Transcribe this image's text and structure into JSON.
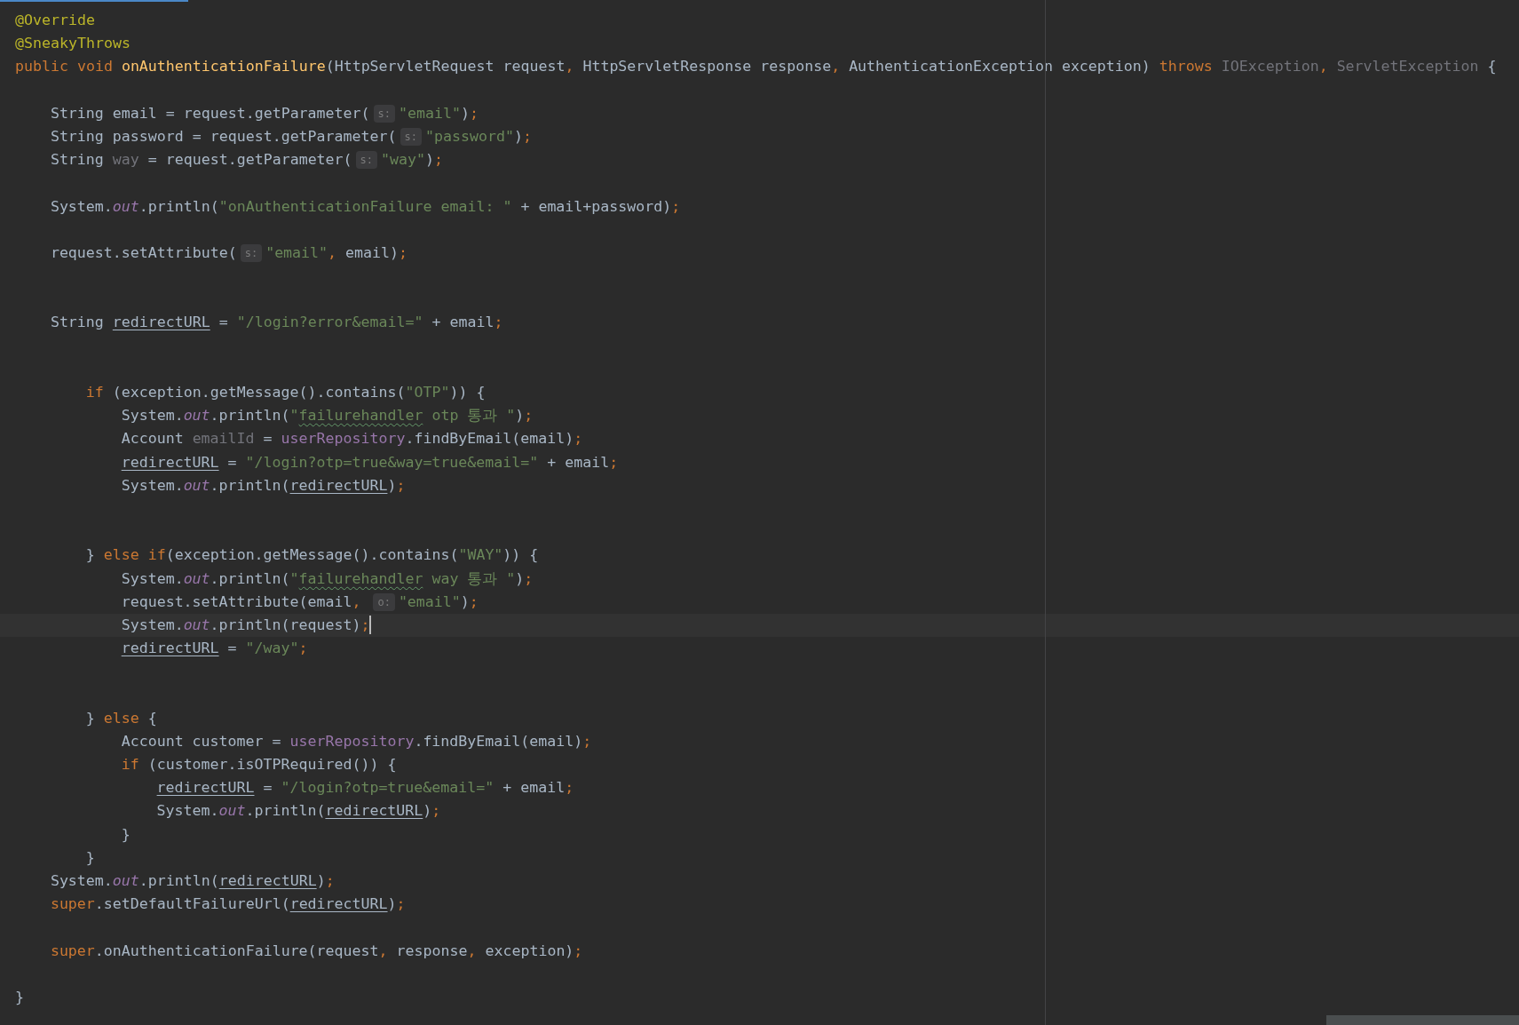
{
  "editor": {
    "lines": [
      {
        "kind": "code",
        "current": false,
        "tokens": [
          {
            "text": "@Override",
            "kind": "annotation"
          }
        ]
      },
      {
        "kind": "code",
        "current": false,
        "tokens": [
          {
            "text": "@SneakyThrows",
            "kind": "annotation"
          }
        ]
      },
      {
        "kind": "code",
        "current": false,
        "tokens": [
          {
            "text": "public void ",
            "kind": "keyword"
          },
          {
            "text": "onAuthenticationFailure",
            "kind": "declaration"
          },
          {
            "text": "(HttpServletRequest request",
            "kind": "plain"
          },
          {
            "text": ", ",
            "kind": "keyword"
          },
          {
            "text": "HttpServletResponse response",
            "kind": "plain"
          },
          {
            "text": ", ",
            "kind": "keyword"
          },
          {
            "text": "AuthenticationException exception) ",
            "kind": "plain"
          },
          {
            "text": "throws ",
            "kind": "keyword"
          },
          {
            "text": "IOException",
            "kind": "unused"
          },
          {
            "text": ", ",
            "kind": "keyword"
          },
          {
            "text": "ServletException",
            "kind": "unused"
          },
          {
            "text": " {",
            "kind": "plain"
          }
        ],
        "children": [
          {
            "kind": "blank",
            "current": false
          },
          {
            "kind": "code",
            "current": false,
            "tokens": [
              {
                "text": "String email = request.getParameter(",
                "kind": "plain"
              },
              {
                "text": "s:",
                "kind": "hint"
              },
              {
                "text": "\"email\"",
                "kind": "string"
              },
              {
                "text": ")",
                "kind": "plain"
              },
              {
                "text": ";",
                "kind": "keyword"
              }
            ]
          },
          {
            "kind": "code",
            "current": false,
            "tokens": [
              {
                "text": "String password = request.getParameter(",
                "kind": "plain"
              },
              {
                "text": "s:",
                "kind": "hint"
              },
              {
                "text": "\"password\"",
                "kind": "string"
              },
              {
                "text": ")",
                "kind": "plain"
              },
              {
                "text": ";",
                "kind": "keyword"
              }
            ]
          },
          {
            "kind": "code",
            "current": false,
            "tokens": [
              {
                "text": "String ",
                "kind": "plain"
              },
              {
                "text": "way",
                "kind": "unused"
              },
              {
                "text": " = request.getParameter(",
                "kind": "plain"
              },
              {
                "text": "s:",
                "kind": "hint"
              },
              {
                "text": "\"way\"",
                "kind": "string"
              },
              {
                "text": ")",
                "kind": "plain"
              },
              {
                "text": ";",
                "kind": "keyword"
              }
            ]
          },
          {
            "kind": "blank",
            "current": false
          },
          {
            "kind": "code",
            "current": false,
            "tokens": [
              {
                "text": "System.",
                "kind": "plain"
              },
              {
                "text": "out",
                "kind": "static-field"
              },
              {
                "text": ".println(",
                "kind": "plain"
              },
              {
                "text": "\"onAuthenticationFailure email: \"",
                "kind": "string"
              },
              {
                "text": " + email+password)",
                "kind": "plain"
              },
              {
                "text": ";",
                "kind": "keyword"
              }
            ]
          },
          {
            "kind": "blank",
            "current": false
          },
          {
            "kind": "code",
            "current": false,
            "tokens": [
              {
                "text": "request.setAttribute(",
                "kind": "plain"
              },
              {
                "text": "s:",
                "kind": "hint"
              },
              {
                "text": "\"email\"",
                "kind": "string"
              },
              {
                "text": ", ",
                "kind": "keyword"
              },
              {
                "text": "email)",
                "kind": "plain"
              },
              {
                "text": ";",
                "kind": "keyword"
              }
            ]
          },
          {
            "kind": "blank",
            "current": false
          },
          {
            "kind": "blank",
            "current": false
          },
          {
            "kind": "code",
            "current": false,
            "tokens": [
              {
                "text": "String ",
                "kind": "plain"
              },
              {
                "text": "redirectURL",
                "kind": "reassigned"
              },
              {
                "text": " = ",
                "kind": "plain"
              },
              {
                "text": "\"/login?error&email=\"",
                "kind": "string"
              },
              {
                "text": " + email",
                "kind": "plain"
              },
              {
                "text": ";",
                "kind": "keyword"
              }
            ]
          },
          {
            "kind": "blank",
            "current": false
          },
          {
            "kind": "blank",
            "current": false,
            "children": [
              {
                "kind": "code",
                "current": false,
                "tokens": [
                  {
                    "text": "if ",
                    "kind": "keyword"
                  },
                  {
                    "text": "(exception.getMessage().contains(",
                    "kind": "plain"
                  },
                  {
                    "text": "\"OTP\"",
                    "kind": "string"
                  },
                  {
                    "text": ")) {",
                    "kind": "plain"
                  }
                ],
                "children": [
                  {
                    "kind": "code",
                    "current": false,
                    "tokens": [
                      {
                        "text": "System.",
                        "kind": "plain"
                      },
                      {
                        "text": "out",
                        "kind": "static-field"
                      },
                      {
                        "text": ".println(",
                        "kind": "plain"
                      },
                      {
                        "text": "\"",
                        "kind": "string"
                      },
                      {
                        "text": "failurehandler",
                        "kind": "typo"
                      },
                      {
                        "text": " otp 통과 \"",
                        "kind": "string"
                      },
                      {
                        "text": ")",
                        "kind": "plain"
                      },
                      {
                        "text": ";",
                        "kind": "keyword"
                      }
                    ]
                  },
                  {
                    "kind": "code",
                    "current": false,
                    "tokens": [
                      {
                        "text": "Account ",
                        "kind": "plain"
                      },
                      {
                        "text": "emailId",
                        "kind": "unused"
                      },
                      {
                        "text": " = ",
                        "kind": "plain"
                      },
                      {
                        "text": "userRepository",
                        "kind": "instance-field"
                      },
                      {
                        "text": ".findByEmail(email)",
                        "kind": "plain"
                      },
                      {
                        "text": ";",
                        "kind": "keyword"
                      }
                    ]
                  },
                  {
                    "kind": "code",
                    "current": false,
                    "tokens": [
                      {
                        "text": "redirectURL",
                        "kind": "reassigned"
                      },
                      {
                        "text": " = ",
                        "kind": "plain"
                      },
                      {
                        "text": "\"/login?otp=true&way=true&email=\"",
                        "kind": "string"
                      },
                      {
                        "text": " + email",
                        "kind": "plain"
                      },
                      {
                        "text": ";",
                        "kind": "keyword"
                      }
                    ]
                  },
                  {
                    "kind": "code",
                    "current": false,
                    "tokens": [
                      {
                        "text": "System.",
                        "kind": "plain"
                      },
                      {
                        "text": "out",
                        "kind": "static-field"
                      },
                      {
                        "text": ".println(",
                        "kind": "plain"
                      },
                      {
                        "text": "redirectURL",
                        "kind": "reassigned"
                      },
                      {
                        "text": ")",
                        "kind": "plain"
                      },
                      {
                        "text": ";",
                        "kind": "keyword"
                      }
                    ]
                  },
                  {
                    "kind": "blank",
                    "current": false
                  },
                  {
                    "kind": "blank",
                    "current": false
                  }
                ]
              },
              {
                "kind": "code",
                "current": false,
                "tokens": [
                  {
                    "text": "} ",
                    "kind": "plain"
                  },
                  {
                    "text": "else if",
                    "kind": "keyword"
                  },
                  {
                    "text": "(exception.getMessage().contains(",
                    "kind": "plain"
                  },
                  {
                    "text": "\"WAY\"",
                    "kind": "string"
                  },
                  {
                    "text": ")) {",
                    "kind": "plain"
                  }
                ],
                "children": [
                  {
                    "kind": "code",
                    "current": false,
                    "tokens": [
                      {
                        "text": "System.",
                        "kind": "plain"
                      },
                      {
                        "text": "out",
                        "kind": "static-field"
                      },
                      {
                        "text": ".println(",
                        "kind": "plain"
                      },
                      {
                        "text": "\"",
                        "kind": "string"
                      },
                      {
                        "text": "failurehandler",
                        "kind": "typo"
                      },
                      {
                        "text": " way 통과 \"",
                        "kind": "string"
                      },
                      {
                        "text": ")",
                        "kind": "plain"
                      },
                      {
                        "text": ";",
                        "kind": "keyword"
                      }
                    ]
                  },
                  {
                    "kind": "code",
                    "current": false,
                    "tokens": [
                      {
                        "text": "request.setAttribute(email",
                        "kind": "plain"
                      },
                      {
                        "text": ", ",
                        "kind": "keyword"
                      },
                      {
                        "text": "o:",
                        "kind": "hint"
                      },
                      {
                        "text": "\"email\"",
                        "kind": "string"
                      },
                      {
                        "text": ")",
                        "kind": "plain"
                      },
                      {
                        "text": ";",
                        "kind": "keyword"
                      }
                    ]
                  },
                  {
                    "kind": "code",
                    "current": true,
                    "tokens": [
                      {
                        "text": "System.",
                        "kind": "plain"
                      },
                      {
                        "text": "out",
                        "kind": "static-field"
                      },
                      {
                        "text": ".println(request)",
                        "kind": "plain"
                      },
                      {
                        "text": ";",
                        "kind": "keyword"
                      }
                    ]
                  },
                  {
                    "kind": "code",
                    "current": false,
                    "tokens": [
                      {
                        "text": "redirectURL",
                        "kind": "reassigned"
                      },
                      {
                        "text": " = ",
                        "kind": "plain"
                      },
                      {
                        "text": "\"/way\"",
                        "kind": "string"
                      },
                      {
                        "text": ";",
                        "kind": "keyword"
                      }
                    ]
                  },
                  {
                    "kind": "blank",
                    "current": false
                  },
                  {
                    "kind": "blank",
                    "current": false
                  }
                ]
              },
              {
                "kind": "code",
                "current": false,
                "tokens": [
                  {
                    "text": "} ",
                    "kind": "plain"
                  },
                  {
                    "text": "else ",
                    "kind": "keyword"
                  },
                  {
                    "text": "{",
                    "kind": "plain"
                  }
                ],
                "children": [
                  {
                    "kind": "code",
                    "current": false,
                    "tokens": [
                      {
                        "text": "Account customer = ",
                        "kind": "plain"
                      },
                      {
                        "text": "userRepository",
                        "kind": "instance-field"
                      },
                      {
                        "text": ".findByEmail(email)",
                        "kind": "plain"
                      },
                      {
                        "text": ";",
                        "kind": "keyword"
                      }
                    ]
                  },
                  {
                    "kind": "code",
                    "current": false,
                    "tokens": [
                      {
                        "text": "if ",
                        "kind": "keyword"
                      },
                      {
                        "text": "(customer.isOTPRequired()) {",
                        "kind": "plain"
                      }
                    ],
                    "children": [
                      {
                        "kind": "code",
                        "current": false,
                        "tokens": [
                          {
                            "text": "redirectURL",
                            "kind": "reassigned"
                          },
                          {
                            "text": " = ",
                            "kind": "plain"
                          },
                          {
                            "text": "\"/login?otp=true&email=\"",
                            "kind": "string"
                          },
                          {
                            "text": " + email",
                            "kind": "plain"
                          },
                          {
                            "text": ";",
                            "kind": "keyword"
                          }
                        ]
                      },
                      {
                        "kind": "code",
                        "current": false,
                        "tokens": [
                          {
                            "text": "System.",
                            "kind": "plain"
                          },
                          {
                            "text": "out",
                            "kind": "static-field"
                          },
                          {
                            "text": ".println(",
                            "kind": "plain"
                          },
                          {
                            "text": "redirectURL",
                            "kind": "reassigned"
                          },
                          {
                            "text": ")",
                            "kind": "plain"
                          },
                          {
                            "text": ";",
                            "kind": "keyword"
                          }
                        ]
                      }
                    ]
                  },
                  {
                    "kind": "code",
                    "current": false,
                    "tokens": [
                      {
                        "text": "}",
                        "kind": "plain"
                      }
                    ]
                  }
                ]
              },
              {
                "kind": "code",
                "current": false,
                "tokens": [
                  {
                    "text": "}",
                    "kind": "plain"
                  }
                ]
              }
            ]
          },
          {
            "kind": "code",
            "current": false,
            "tokens": [
              {
                "text": "System.",
                "kind": "plain"
              },
              {
                "text": "out",
                "kind": "static-field"
              },
              {
                "text": ".println(",
                "kind": "plain"
              },
              {
                "text": "redirectURL",
                "kind": "reassigned"
              },
              {
                "text": ")",
                "kind": "plain"
              },
              {
                "text": ";",
                "kind": "keyword"
              }
            ]
          },
          {
            "kind": "code",
            "current": false,
            "tokens": [
              {
                "text": "super",
                "kind": "keyword"
              },
              {
                "text": ".setDefaultFailureUrl(",
                "kind": "plain"
              },
              {
                "text": "redirectURL",
                "kind": "reassigned"
              },
              {
                "text": ")",
                "kind": "plain"
              },
              {
                "text": ";",
                "kind": "keyword"
              }
            ]
          },
          {
            "kind": "blank",
            "current": false
          },
          {
            "kind": "code",
            "current": false,
            "tokens": [
              {
                "text": "super",
                "kind": "keyword"
              },
              {
                "text": ".onAuthenticationFailure(request",
                "kind": "plain"
              },
              {
                "text": ", ",
                "kind": "keyword"
              },
              {
                "text": "response",
                "kind": "plain"
              },
              {
                "text": ", ",
                "kind": "keyword"
              },
              {
                "text": "exception)",
                "kind": "plain"
              },
              {
                "text": ";",
                "kind": "keyword"
              }
            ]
          },
          {
            "kind": "blank",
            "current": false
          }
        ]
      },
      {
        "kind": "code",
        "current": false,
        "tokens": [
          {
            "text": "}",
            "kind": "plain"
          }
        ]
      }
    ]
  }
}
